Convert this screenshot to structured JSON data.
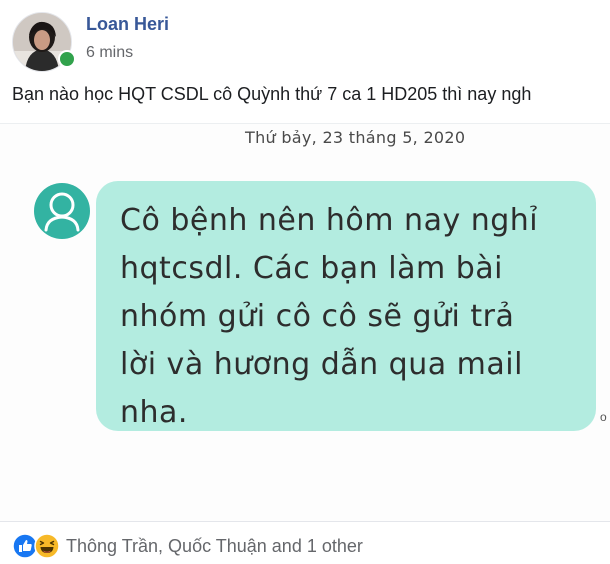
{
  "post": {
    "author_name": "Loan Heri",
    "time": "6 mins",
    "text": "Bạn nào học HQT CSDL cô Quỳnh thứ 7 ca 1 HD205 thì nay ngh"
  },
  "image": {
    "date_header": "Thứ bảy, 23 tháng 5, 2020",
    "message_lines": [
      "Cô bệnh nên hôm nay nghỉ",
      "hqtcsdl. Các bạn làm bài",
      "nhóm gửi cô cô sẽ gửi trả",
      "lời và hương dẫn qua mail",
      "nha."
    ],
    "side_mark": "o",
    "bubble_color": "#b3ece0"
  },
  "reactions": {
    "icons": [
      "like-icon",
      "haha-icon"
    ],
    "summary": "Thông Trần, Quốc Thuận and 1 other"
  },
  "colors": {
    "author": "#385898",
    "online": "#31a24c",
    "like": "#1877f2",
    "haha": "#f7b928"
  }
}
